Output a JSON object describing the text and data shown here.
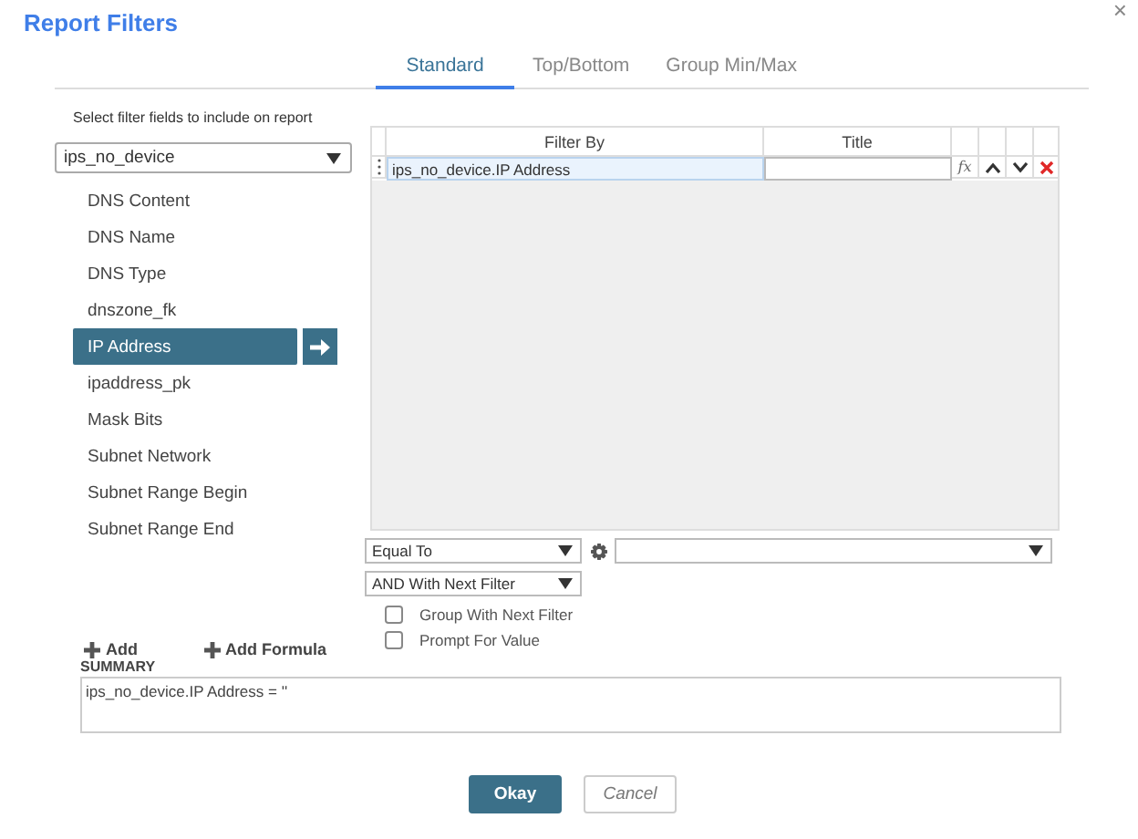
{
  "dialog": {
    "title": "Report Filters",
    "close": "×"
  },
  "tabs": [
    {
      "label": "Standard",
      "selected": true
    },
    {
      "label": "Top/Bottom",
      "selected": false
    },
    {
      "label": "Group Min/Max",
      "selected": false
    }
  ],
  "field_picker": {
    "instruction": "Select filter fields to include on report",
    "table_select": "ips_no_device",
    "fields": [
      {
        "label": "DNS Content",
        "selected": false
      },
      {
        "label": "DNS Name",
        "selected": false
      },
      {
        "label": "DNS Type",
        "selected": false
      },
      {
        "label": "dnszone_fk",
        "selected": false
      },
      {
        "label": "IP Address",
        "selected": true
      },
      {
        "label": "ipaddress_pk",
        "selected": false
      },
      {
        "label": "Mask Bits",
        "selected": false
      },
      {
        "label": "Subnet Network",
        "selected": false
      },
      {
        "label": "Subnet Range Begin",
        "selected": false
      },
      {
        "label": "Subnet Range End",
        "selected": false
      }
    ],
    "add_links": [
      "Add",
      "Add Formula"
    ]
  },
  "filter_grid": {
    "columns": [
      "Filter By",
      "Title"
    ],
    "rows": [
      {
        "filter_by": "ips_no_device.IP Address",
        "formula_button": "fx",
        "selected": true
      }
    ]
  },
  "options": {
    "operator": "Equal To",
    "join": "AND With Next Filter",
    "checkboxes": [
      {
        "label": "Group With Next Filter",
        "checked": false
      },
      {
        "label": "Prompt For Value",
        "checked": false
      }
    ]
  },
  "summary": {
    "label": "SUMMARY",
    "text": "ips_no_device.IP Address = ''"
  },
  "buttons": [
    {
      "label": "Okay",
      "kind": "primary"
    },
    {
      "label": "Cancel",
      "kind": "secondary"
    }
  ]
}
